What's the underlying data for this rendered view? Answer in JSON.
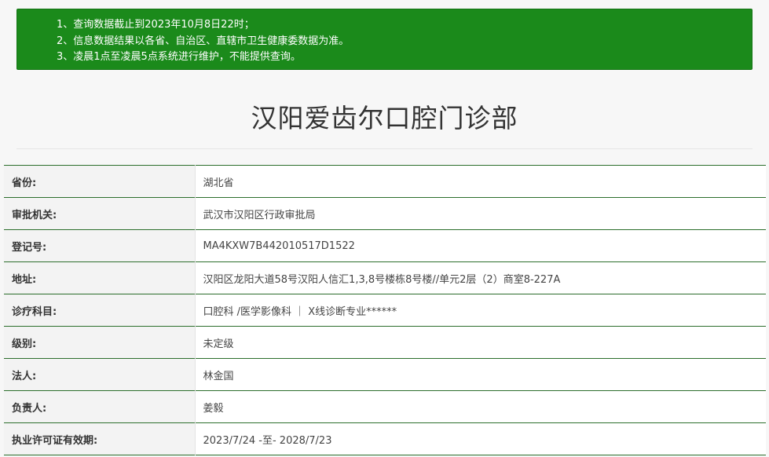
{
  "notice": {
    "lines": [
      "1、查询数据截止到2023年10月8日22时；",
      "2、信息数据结果以各省、自治区、直辖市卫生健康委数据为准。",
      "3、凌晨1点至凌晨5点系统进行维护，不能提供查询。"
    ]
  },
  "clinic": {
    "name": "汉阳爱齿尔口腔门诊部"
  },
  "info": {
    "rows": [
      {
        "label": "省份:",
        "value": "湖北省"
      },
      {
        "label": "审批机关:",
        "value": "武汉市汉阳区行政审批局"
      },
      {
        "label": "登记号:",
        "value": "MA4KXW7B442010517D1522"
      },
      {
        "label": "地址:",
        "value": "汉阳区龙阳大道58号汉阳人信汇1,3,8号楼栋8号楼//单元2层（2）商室8-227A"
      },
      {
        "label": "诊疗科目:",
        "value": "口腔科 /医学影像科 ｜ X线诊断专业******"
      },
      {
        "label": "级别:",
        "value": "未定级"
      },
      {
        "label": "法人:",
        "value": "林金国"
      },
      {
        "label": "负责人:",
        "value": "姜毅"
      },
      {
        "label": "执业许可证有效期:",
        "value": "2023/7/24 -至- 2028/7/23"
      }
    ]
  }
}
